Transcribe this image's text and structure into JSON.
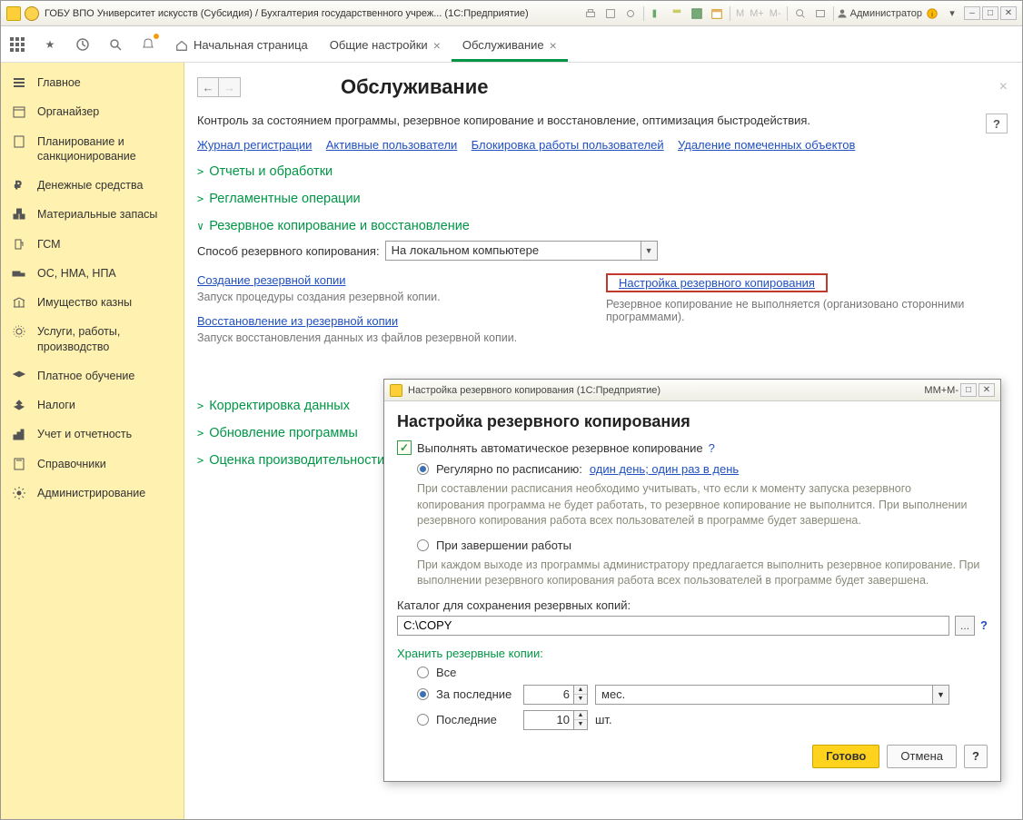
{
  "app": {
    "title": "ГОБУ ВПО Университет искусств (Субсидия) / Бухгалтерия государственного учреж...  (1С:Предприятие)",
    "username": "Администратор"
  },
  "tabs": {
    "home": "Начальная страница",
    "t1": "Общие настройки",
    "t2": "Обслуживание"
  },
  "sidebar": {
    "items": [
      "Главное",
      "Органайзер",
      "Планирование и санкционирование",
      "Денежные средства",
      "Материальные запасы",
      "ГСМ",
      "ОС, НМА, НПА",
      "Имущество казны",
      "Услуги, работы, производство",
      "Платное обучение",
      "Налоги",
      "Учет и отчетность",
      "Справочники",
      "Администрирование"
    ]
  },
  "page": {
    "title": "Обслуживание",
    "desc": "Контроль за состоянием программы, резервное копирование и восстановление, оптимизация быстродействия.",
    "help": "?"
  },
  "links": {
    "l1": "Журнал регистрации",
    "l2": "Активные пользователи",
    "l3": "Блокировка работы пользователей",
    "l4": "Удаление помеченных объектов"
  },
  "sections": {
    "s1": "Отчеты и обработки",
    "s2": "Регламентные операции",
    "s3": "Резервное копирование и восстановление",
    "s4": "Корректировка данных",
    "s5": "Обновление программы",
    "s6": "Оценка производительности"
  },
  "backup": {
    "method_label": "Способ резервного копирования:",
    "method_value": "На локальном компьютере",
    "create_link": "Создание резервной копии",
    "create_hint": "Запуск процедуры создания резервной копии.",
    "restore_link": "Восстановление из резервной копии",
    "restore_hint": "Запуск восстановления данных из файлов резервной копии.",
    "settings_link": "Настройка резервного копирования",
    "settings_hint": "Резервное копирование не выполняется (организовано сторонними программами)."
  },
  "dlg": {
    "wintitle": "Настройка резервного копирования  (1С:Предприятие)",
    "header": "Настройка резервного копирования",
    "chk_label": "Выполнять автоматическое резервное копирование",
    "qmark": "?",
    "opt_schedule": "Регулярно по расписанию:",
    "schedule_link": "один день; один раз в день",
    "schedule_hint": "При составлении расписания необходимо учитывать, что если к моменту запуска резервного копирования программа не будет работать, то резервное копирование не выполнится. При выполнении резервного копирования работа всех пользователей в программе будет завершена.",
    "opt_exit": "При завершении работы",
    "exit_hint": "При каждом выходе из программы администратору предлагается выполнить резервное копирование. При выполнении резервного копирования работа всех пользователей в программе будет завершена.",
    "path_label": "Каталог для сохранения резервных копий:",
    "path_value": "C:\\COPY",
    "ellipsis": "...",
    "keep_label": "Хранить резервные копии:",
    "keep_all": "Все",
    "keep_lastn": "За последние",
    "keep_lastn_val": "6",
    "keep_lastn_unit": "мес.",
    "keep_lastc": "Последние",
    "keep_lastc_val": "10",
    "keep_lastc_unit": "шт.",
    "ok": "Готово",
    "cancel": "Отмена"
  },
  "mlabels": {
    "m": "M",
    "mp": "M+",
    "mm": "M-"
  }
}
